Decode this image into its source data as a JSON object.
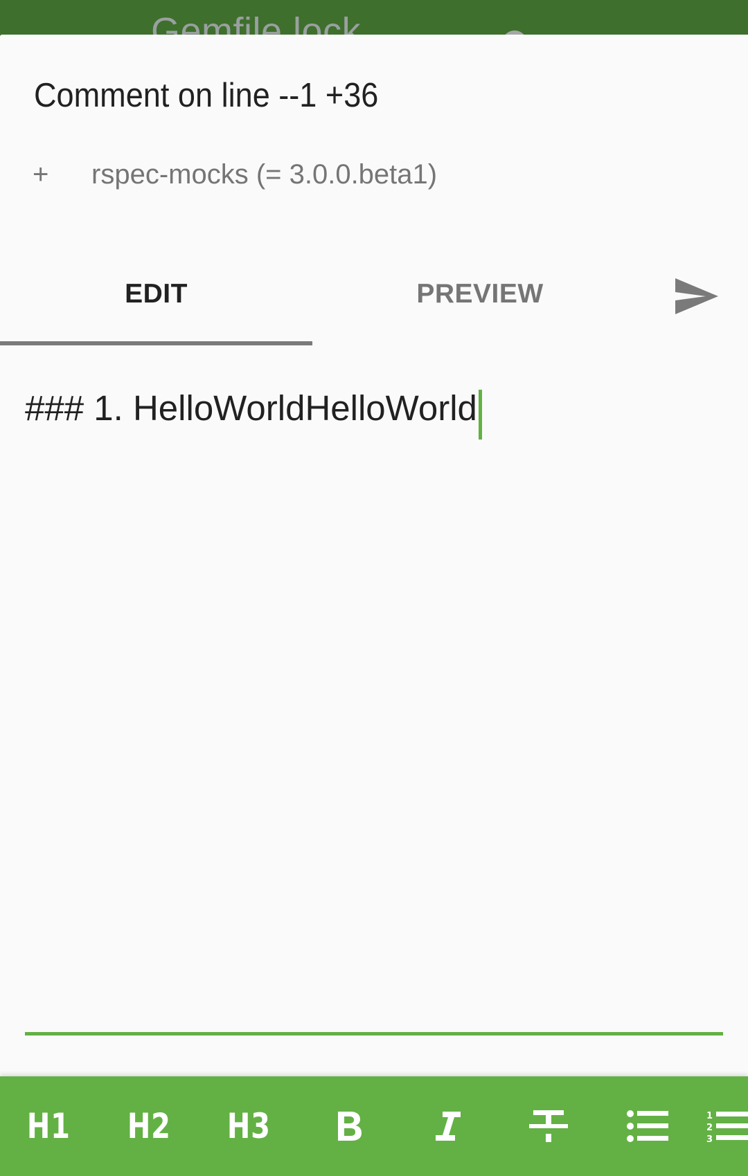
{
  "background": {
    "toolbar_title": "Gemfile.lock",
    "toolbar_color": "#3e6f2c"
  },
  "dialog": {
    "title": "Comment on line --1 +36",
    "diff_line": {
      "marker": "+",
      "code": "rspec-mocks (= 3.0.0.beta1)"
    }
  },
  "tabs": [
    {
      "label": "EDIT",
      "selected": true
    },
    {
      "label": "PREVIEW",
      "selected": false
    }
  ],
  "send_icon": "send-icon",
  "editor": {
    "value": "### 1. HelloWorldHelloWorld",
    "accent_color": "#63b144"
  },
  "markdown_toolbar": {
    "color": "#63b144",
    "buttons": [
      {
        "label": "H1",
        "icon": "heading-1"
      },
      {
        "label": "H2",
        "icon": "heading-2"
      },
      {
        "label": "H3",
        "icon": "heading-3"
      },
      {
        "label": "B",
        "icon": "bold-icon"
      },
      {
        "label": "I",
        "icon": "italic-icon"
      },
      {
        "label": "",
        "icon": "strikethrough-icon"
      },
      {
        "label": "",
        "icon": "bulleted-list-icon"
      },
      {
        "label": "",
        "icon": "numbered-list-icon"
      }
    ]
  }
}
